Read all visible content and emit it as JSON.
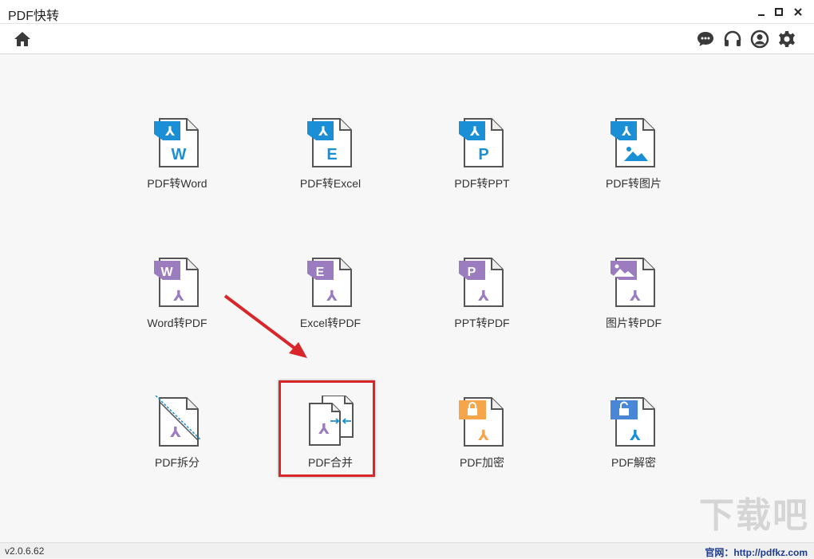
{
  "app": {
    "title": "PDF快转"
  },
  "window_controls": {
    "minimize": "minimize-icon",
    "maximize": "maximize-icon",
    "close": "close-icon"
  },
  "toolbar": {
    "home": "home-icon",
    "right_icons": [
      "chat-icon",
      "headset-icon",
      "user-icon",
      "gear-icon"
    ]
  },
  "colors": {
    "accent_blue": "#1a8fd6",
    "purple": "#9b7cbf",
    "orange": "#f5a64a",
    "highlight_red": "#d9262a"
  },
  "tiles": [
    {
      "label": "PDF转Word",
      "icon": "pdf-to-word-icon"
    },
    {
      "label": "PDF转Excel",
      "icon": "pdf-to-excel-icon"
    },
    {
      "label": "PDF转PPT",
      "icon": "pdf-to-ppt-icon"
    },
    {
      "label": "PDF转图片",
      "icon": "pdf-to-image-icon"
    },
    {
      "label": "Word转PDF",
      "icon": "word-to-pdf-icon"
    },
    {
      "label": "Excel转PDF",
      "icon": "excel-to-pdf-icon"
    },
    {
      "label": "PPT转PDF",
      "icon": "ppt-to-pdf-icon"
    },
    {
      "label": "图片转PDF",
      "icon": "image-to-pdf-icon"
    },
    {
      "label": "PDF拆分",
      "icon": "pdf-split-icon"
    },
    {
      "label": "PDF合并",
      "icon": "pdf-merge-icon",
      "highlighted": true
    },
    {
      "label": "PDF加密",
      "icon": "pdf-encrypt-icon"
    },
    {
      "label": "PDF解密",
      "icon": "pdf-decrypt-icon"
    }
  ],
  "status": {
    "version": "v2.0.6.62",
    "website": "官网：http://pdfkz.com"
  },
  "watermark": "下载吧"
}
